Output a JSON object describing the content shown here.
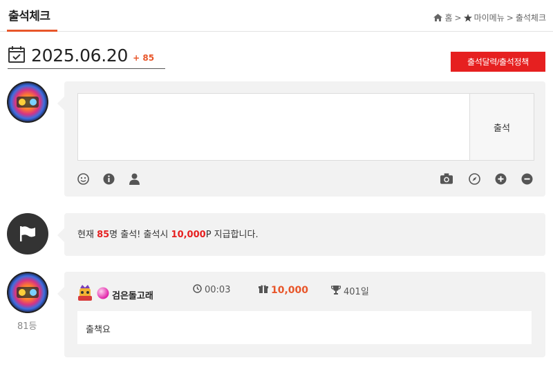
{
  "header": {
    "title": "출석체크",
    "breadcrumb": {
      "home": "홈",
      "sep1": ">",
      "mymenu": "마이메뉴",
      "sep2": ">",
      "current": "출석체크"
    }
  },
  "date_bar": {
    "date": "2025.06.20",
    "count": "+ 85",
    "policy_button": "출석달력/출석정책"
  },
  "write": {
    "submit_label": "출석",
    "value": "",
    "placeholder": ""
  },
  "tools_left": [
    "smile-icon",
    "info-icon",
    "user-icon"
  ],
  "tools_right": [
    "camera-icon",
    "compass-icon",
    "plus-circle-icon",
    "minus-circle-icon"
  ],
  "notice": {
    "prefix": "현재 ",
    "count": "85",
    "mid": "명 출석! 출석시 ",
    "point": "10,000",
    "suffix": "P 지급합니다."
  },
  "entry": {
    "nickname": "검은돌고래",
    "time": "00:03",
    "point": "10,000",
    "days": "401일",
    "comment": "출책요",
    "rank": "81등"
  },
  "colors": {
    "accent": "#e8562a",
    "red": "#e62020",
    "panel": "#f2f2f2"
  }
}
